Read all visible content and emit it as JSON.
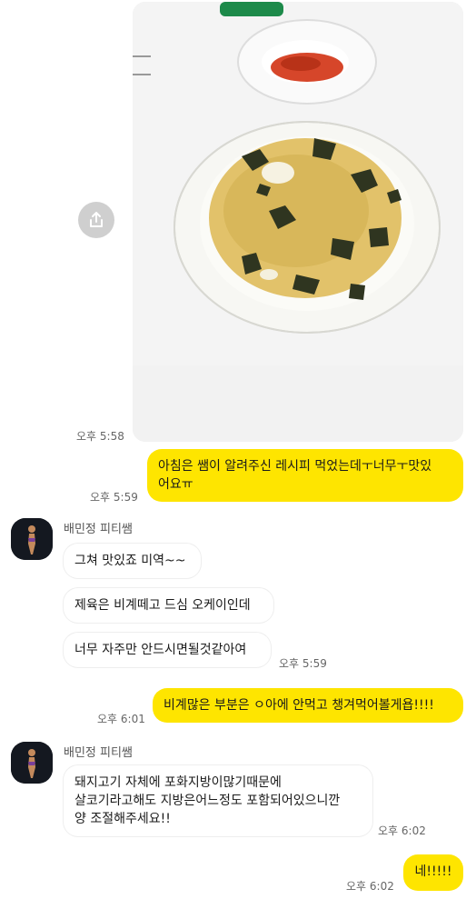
{
  "messages": [
    {
      "type": "image",
      "from": "me",
      "time": "오후 5:58"
    },
    {
      "from": "me",
      "text": "아침은 쌤이 알려주신 레시피 먹었는데ㅜ너무ㅜ맛있\n어요ㅠ",
      "time": "오후 5:59"
    },
    {
      "from": "them",
      "sender": "배민정 피티쌤",
      "bubbles": [
        "그쳐 맛있죠 미역~~",
        "제육은 비계떼고 드심 오케이인데",
        "너무 자주만 안드시면될것같아여"
      ],
      "time": "오후 5:59"
    },
    {
      "from": "me",
      "text": "비계많은 부분은 ㅇ아에 안먹고 챙겨먹어볼게욥!!!!",
      "time": "오후 6:01"
    },
    {
      "from": "them",
      "sender": "배민정 피티쌤",
      "bubbles": [
        "돼지고기 자체에 포화지방이많기때문에\n살코기라고해도 지방은어느정도 포함되어있으니깐\n양 조절해주세요!!"
      ],
      "time": "오후 6:02"
    },
    {
      "from": "me",
      "text": "네!!!!!",
      "time": "오후 6:02"
    }
  ],
  "colors": {
    "my_bubble": "#fee500",
    "their_bubble": "#ffffff"
  }
}
